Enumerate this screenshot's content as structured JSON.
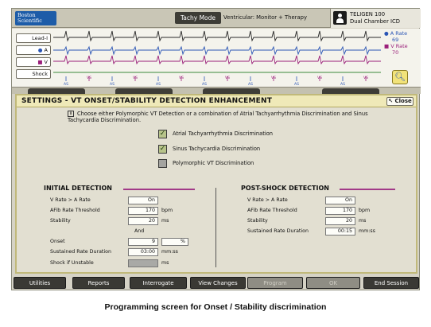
{
  "header": {
    "logo_text": "Boston Scientific",
    "mode_button": "Tachy Mode",
    "mode_status": "Ventricular: Monitor + Therapy",
    "device_name": "TELIGEN 100",
    "device_type": "Dual Chamber ICD"
  },
  "egm": {
    "channels": [
      "Lead-I",
      "A",
      "V",
      "Shock"
    ],
    "atrial_rate_label": "A Rate",
    "atrial_rate_value": "69",
    "ventricular_rate_label": "V Rate",
    "ventricular_rate_value": "70",
    "marker_labels": [
      "VS",
      "AS"
    ]
  },
  "dialog": {
    "title": "SETTINGS - VT ONSET/STABILITY DETECTION ENHANCEMENT",
    "close_label": "Close",
    "info_text": "Choose either Polymorphic VT Detection or a combination of Atrial Tachyarrhythmia Discrimination and Sinus Tachycardia Discrimination.",
    "options": [
      {
        "label": "Atrial Tachyarrhythmia Discrimination",
        "checked": true
      },
      {
        "label": "Sinus Tachycardia Discrimination",
        "checked": true
      },
      {
        "label": "Polymorphic VT Discrimination",
        "checked": false
      }
    ]
  },
  "initial": {
    "title": "INITIAL DETECTION",
    "rows": [
      {
        "label": "V Rate > A Rate",
        "value": "On",
        "unit": ""
      },
      {
        "label": "AFib Rate Threshold",
        "value": "170",
        "unit": "bpm"
      },
      {
        "label": "Stability",
        "value": "20",
        "unit": "ms"
      },
      {
        "label": "And",
        "value": "",
        "unit": ""
      },
      {
        "label": "Onset",
        "value": "9",
        "unit": "%"
      },
      {
        "label": "Sustained Rate Duration",
        "value": "03:00",
        "unit": "mm:ss"
      },
      {
        "label": "Shock if Unstable",
        "value": "",
        "unit": "ms"
      }
    ]
  },
  "postshock": {
    "title": "POST-SHOCK DETECTION",
    "rows": [
      {
        "label": "V Rate > A Rate",
        "value": "On",
        "unit": ""
      },
      {
        "label": "AFib Rate Threshold",
        "value": "170",
        "unit": "bpm"
      },
      {
        "label": "Stability",
        "value": "20",
        "unit": "ms"
      },
      {
        "label": "Sustained Rate Duration",
        "value": "00:15",
        "unit": "mm:ss"
      }
    ]
  },
  "buttons": [
    "Utilities",
    "Reports",
    "Interrogate",
    "View Changes",
    "Program",
    "OK",
    "End Session"
  ],
  "caption": "Programming screen for Onset / Stability discrimination",
  "colors": {
    "atrial": "#2a55b5",
    "ventricular": "#9a1f7a",
    "panel_accent": "#a23a88",
    "title_bar": "#efe9b8"
  }
}
